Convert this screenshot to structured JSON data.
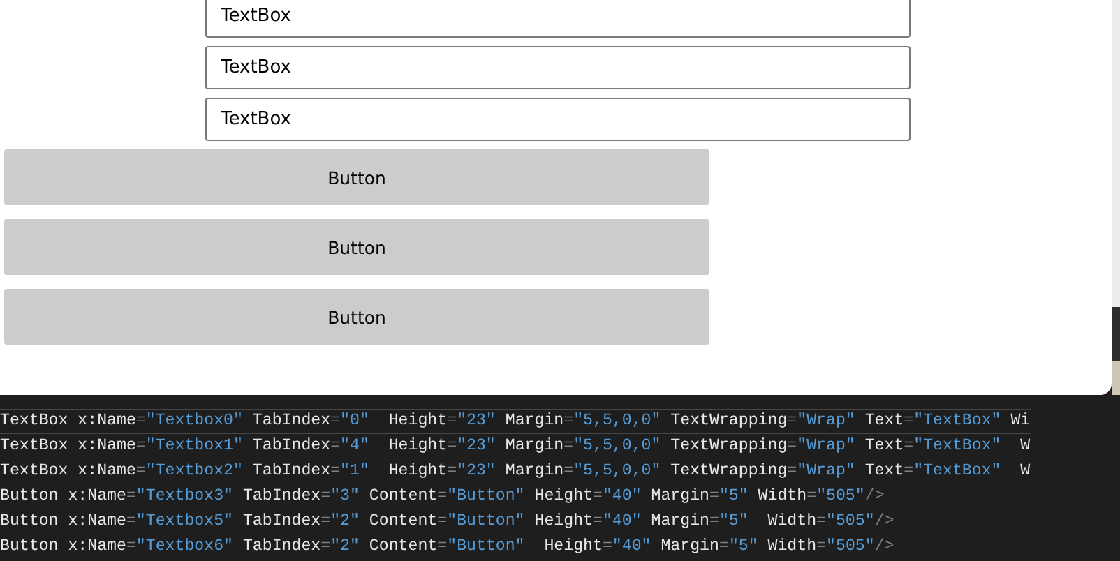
{
  "window": {
    "textboxes": [
      {
        "value": "TextBox"
      },
      {
        "value": "TextBox"
      },
      {
        "value": "TextBox"
      }
    ],
    "buttons": [
      "Button",
      "Button",
      "Button"
    ]
  },
  "code_lines": [
    {
      "text": "TextBox x:Name=\"Textbox0\" TabIndex=\"0\"  Height=\"23\" Margin=\"5,5,0,0\" TextWrapping=\"Wrap\" Text=\"TextBox\" Wi",
      "highlighted": true
    },
    {
      "text": "TextBox x:Name=\"Textbox1\" TabIndex=\"4\"  Height=\"23\" Margin=\"5,5,0,0\" TextWrapping=\"Wrap\" Text=\"TextBox\"  W",
      "highlighted": false
    },
    {
      "text": "TextBox x:Name=\"Textbox2\" TabIndex=\"1\"  Height=\"23\" Margin=\"5,5,0,0\" TextWrapping=\"Wrap\" Text=\"TextBox\"  W",
      "highlighted": false
    },
    {
      "text": "Button x:Name=\"Textbox3\" TabIndex=\"3\" Content=\"Button\" Height=\"40\" Margin=\"5\" Width=\"505\"/>",
      "highlighted": false
    },
    {
      "text": "Button x:Name=\"Textbox5\" TabIndex=\"2\" Content=\"Button\" Height=\"40\" Margin=\"5\"  Width=\"505\"/>",
      "highlighted": false
    },
    {
      "text": "Button x:Name=\"Textbox6\" TabIndex=\"2\" Content=\"Button\"  Height=\"40\" Margin=\"5\" Width=\"505\"/>",
      "highlighted": false
    }
  ]
}
